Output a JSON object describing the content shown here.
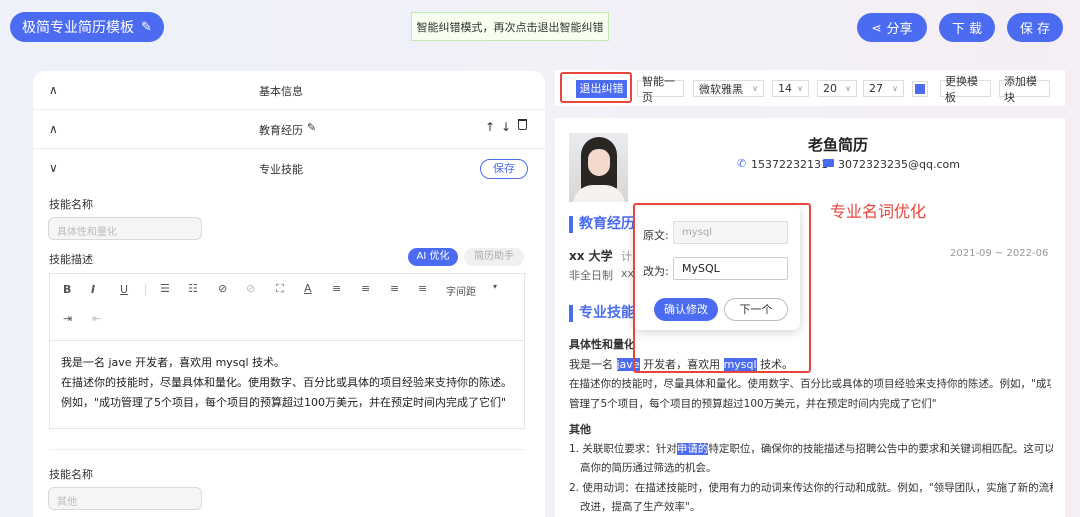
{
  "header": {
    "template_title": "极简专业简历模板",
    "hint": "智能纠错模式，再次点击退出智能纠错",
    "share_label": "分享",
    "download_label": "下 载",
    "save_label": "保 存"
  },
  "left": {
    "sections": [
      {
        "title": "基本信息"
      },
      {
        "title": "教育经历"
      },
      {
        "title": "专业技能",
        "save_label": "保存"
      }
    ],
    "skill_name_label": "技能名称",
    "skill_name_placeholder": "具体性和量化",
    "skill_desc_label": "技能描述",
    "ai_label": "AI 优化",
    "assistant_label": "简历助手",
    "line_height_label": "字间距",
    "editor_lines": [
      "我是一名 jave 开发者，喜欢用 mysql 技术。",
      "在描述你的技能时，尽量具体和量化。使用数字、百分比或具体的项目经验来支持你的陈述。",
      "例如，\"成功管理了5个项目，每个项目的预算超过100万美元，并在预定时间内完成了它们\""
    ],
    "skill_name_label2": "技能名称",
    "skill_name_placeholder2": "其他"
  },
  "toolbar": {
    "exit_label": "退出纠错",
    "one_page_label": "智能一页",
    "font": "微软雅黑",
    "size1": "14",
    "size2": "20",
    "size3": "27",
    "accent_color": "#4b6cf0",
    "change_template_label": "更换模板",
    "add_module_label": "添加模块"
  },
  "resume": {
    "name": "老鱼简历",
    "phone": "15372232131",
    "email": "3072323235@qq.com",
    "edu_heading": "教育经历",
    "school": "xx 大学",
    "school_major_fragment": "计",
    "edu_type": "非全日制",
    "edu_type_fragment": "xx",
    "edu_dates": "2021-09 ~ 2022-06",
    "skills_heading": "专业技能",
    "skill_title": "具体性和量化",
    "line1_a": "我是一名 ",
    "line1_hl1": "jave",
    "line1_b": " 开发者，喜欢用 ",
    "line1_hl2": "mysql",
    "line1_c": " 技术。",
    "line2": "在描述你的技能时，尽量具体和量化。使用数字、百分比或具体的项目经验来支持你的陈述。例如，\"成功",
    "line3": "管理了5个项目，每个项目的预算超过100万美元，并在预定时间内完成了它们\"",
    "other_heading": "其他",
    "item1_a": "1. 关联职位要求：针对",
    "item1_hl": "申请的",
    "item1_b": "特定职位，确保你的技能描述与招聘公告中的要求和关键词相匹配。这可以提",
    "item1_c": "高你的简历通过筛选的机会。",
    "item2_a": "2. 使用动词：在描述技能时，使用有力的动词来传达你的行动和成就。例如，\"领导团队，实施了新的流程",
    "item2_b": "改进，提高了生产效率\"。"
  },
  "popup": {
    "original_label": "原文:",
    "original_value": "mysql",
    "change_label": "改为:",
    "change_value": "MySQL",
    "confirm_label": "确认修改",
    "next_label": "下一个"
  },
  "annotation": "专业名词优化"
}
